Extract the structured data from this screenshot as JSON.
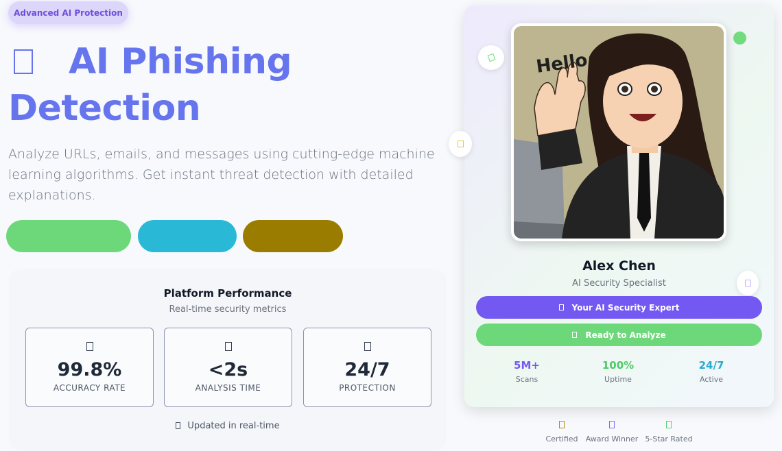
{
  "badge": "Advanced AI Protection",
  "hero": {
    "title_line1": "AI Phishing",
    "title_line2": "Detection",
    "description": "Analyze URLs, emails, and messages using cutting-edge machine learning algorithms. Get instant threat detection with detailed explanations.",
    "icon": "shield-icon"
  },
  "action_pills": [
    {
      "name": "green-pill",
      "color": "#6dd87a"
    },
    {
      "name": "cyan-pill",
      "color": "#29b9d6"
    },
    {
      "name": "olive-pill",
      "color": "#9a7c00"
    }
  ],
  "performance": {
    "title": "Platform Performance",
    "subtitle": "Real-time security metrics",
    "metrics": [
      {
        "value": "99.8%",
        "label": "ACCURACY RATE",
        "icon": "target-icon"
      },
      {
        "value": "<2s",
        "label": "ANALYSIS TIME",
        "icon": "bolt-icon"
      },
      {
        "value": "24/7",
        "label": "PROTECTION",
        "icon": "shield-icon"
      }
    ],
    "updated": "Updated in real-time"
  },
  "profile": {
    "photo_text": "Hello",
    "name": "Alex Chen",
    "role": "AI Security Specialist",
    "expert_button": "Your AI Security Expert",
    "ready_button": "Ready to Analyze",
    "stats": [
      {
        "value": "5M+",
        "label": "Scans"
      },
      {
        "value": "100%",
        "label": "Uptime"
      },
      {
        "value": "24/7",
        "label": "Active"
      }
    ]
  },
  "trust_badges": [
    {
      "label": "Certified",
      "icon": "certificate-icon"
    },
    {
      "label": "Award Winner",
      "icon": "trophy-icon"
    },
    {
      "label": "5-Star Rated",
      "icon": "star-icon"
    }
  ],
  "colors": {
    "accent": "#6675ee",
    "purple": "#7358f1",
    "green": "#6dd87a",
    "cyan": "#29b9d6",
    "olive": "#9a7c00"
  }
}
